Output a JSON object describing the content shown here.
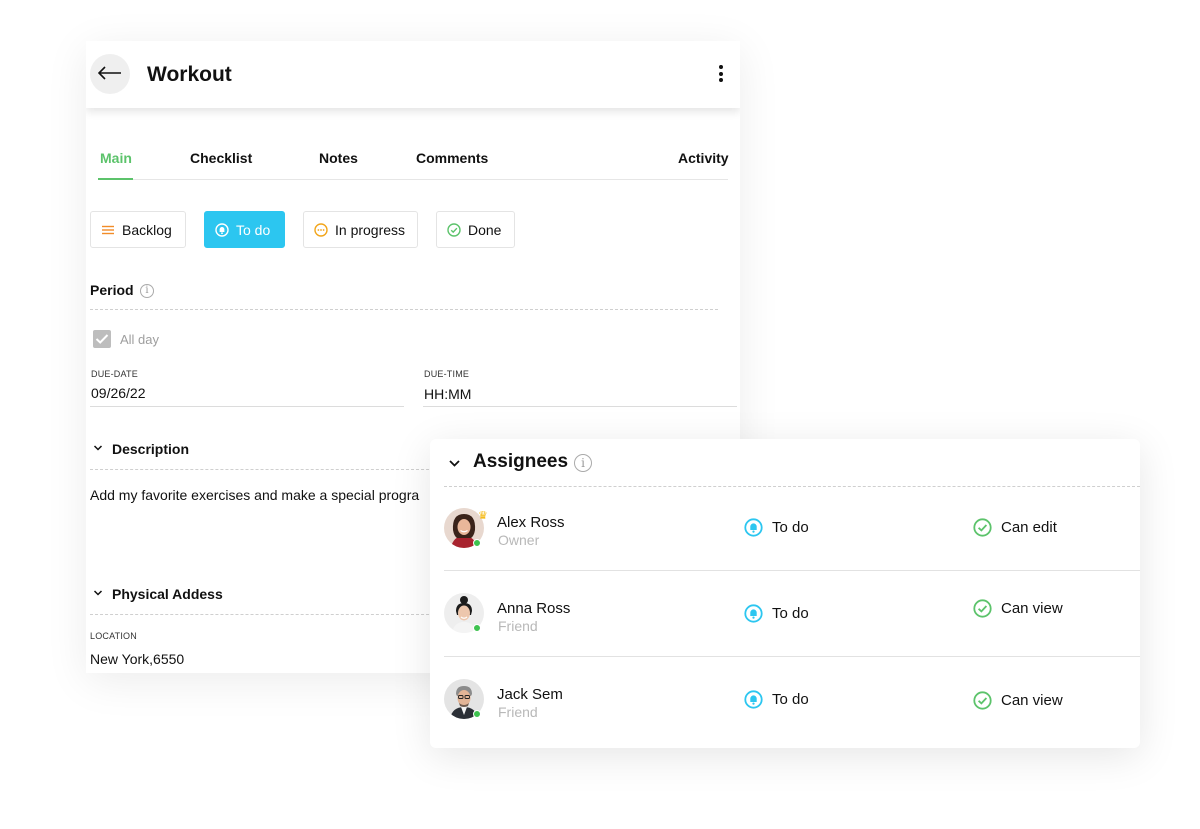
{
  "header": {
    "title": "Workout"
  },
  "tabs": [
    {
      "label": "Main",
      "active": true
    },
    {
      "label": "Checklist",
      "active": false
    },
    {
      "label": "Notes",
      "active": false
    },
    {
      "label": "Comments",
      "active": false
    },
    {
      "label": "Activity",
      "active": false
    }
  ],
  "statuses": [
    {
      "label": "Backlog",
      "icon": "menu-lines-icon",
      "color": "#f28c28",
      "active": false
    },
    {
      "label": "To do",
      "icon": "bell-icon",
      "color": "#2cc6f0",
      "active": true
    },
    {
      "label": "In progress",
      "icon": "dots-circle-icon",
      "color": "#f2a51a",
      "active": false
    },
    {
      "label": "Done",
      "icon": "check-circle-icon",
      "color": "#5cc36b",
      "active": false
    }
  ],
  "period": {
    "label": "Period",
    "all_day_label": "All day",
    "all_day_checked": true,
    "due_date_caption": "DUE-DATE",
    "due_date_value": "09/26/22",
    "due_time_caption": "DUE-TIME",
    "due_time_value": "HH:MM"
  },
  "description": {
    "label": "Description",
    "text": "Add my favorite exercises and make a special progra"
  },
  "address": {
    "label": "Physical Addess",
    "location_caption": "LOCATION",
    "location_value": "New York,6550"
  },
  "assignees": {
    "title": "Assignees",
    "rows": [
      {
        "name": "Alex Ross",
        "role": "Owner",
        "status": "To do",
        "permission": "Can edit",
        "owner": true
      },
      {
        "name": "Anna Ross",
        "role": "Friend",
        "status": "To do",
        "permission": "Can view",
        "owner": false
      },
      {
        "name": "Jack Sem",
        "role": "Friend",
        "status": "To do",
        "permission": "Can view",
        "owner": false
      }
    ]
  },
  "colors": {
    "accent_green": "#5cc36b",
    "todo_blue": "#2cc6f0",
    "online_green": "#3ec24f"
  }
}
